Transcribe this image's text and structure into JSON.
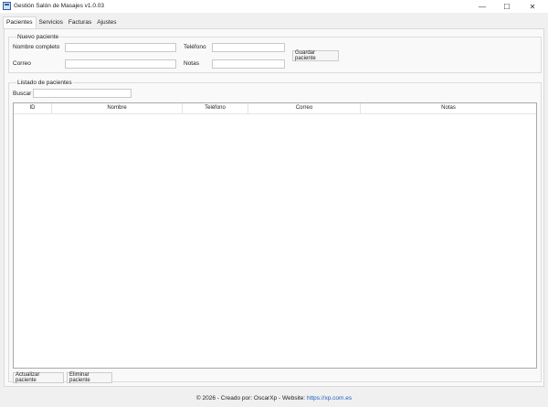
{
  "window": {
    "title": "Gestión Salón de Masajes v1.0.03",
    "minimize_glyph": "—",
    "maximize_glyph": "☐",
    "close_glyph": "✕"
  },
  "tabs": [
    {
      "label": "Pacientes",
      "active": true
    },
    {
      "label": "Servicios",
      "active": false
    },
    {
      "label": "Facturas",
      "active": false
    },
    {
      "label": "Ajustes",
      "active": false
    }
  ],
  "new_patient": {
    "title": "Nuevo paciente",
    "name_label": "Nombre completo",
    "name_value": "",
    "phone_label": "Teléfono",
    "phone_value": "",
    "email_label": "Correo",
    "email_value": "",
    "notes_label": "Notas",
    "notes_value": "",
    "save_label": "Guardar paciente"
  },
  "list": {
    "title": "Listado de pacientes",
    "search_label": "Buscar",
    "search_value": "",
    "columns": [
      "ID",
      "Nombre",
      "Teléfono",
      "Correo",
      "Notas"
    ],
    "rows": []
  },
  "actions": {
    "update_label": "Actualizar paciente",
    "delete_label": "Eliminar paciente"
  },
  "footer": {
    "text": "© 2026 - Creado por: OscarXp - Website:",
    "link": "https://xp.com.es"
  },
  "colors": {
    "link": "#1f5fbf",
    "icon_accent": "#2d5fa8"
  },
  "icons": {
    "app": "app-icon"
  }
}
